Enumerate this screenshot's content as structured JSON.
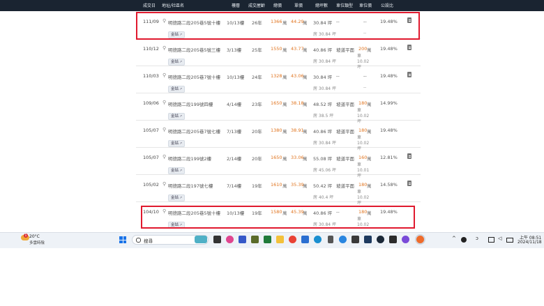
{
  "header": {
    "columns": [
      "成交日",
      "地址/社區名",
      "樓層",
      "成交屋齡",
      "總價",
      "單價",
      "總坪數",
      "車位類型",
      "車位價",
      "公設比"
    ]
  },
  "rows": [
    {
      "date": "111/09",
      "address": "明德路二段205巷5號十樓",
      "floor": "10/13樓",
      "age": "26年",
      "total": "1366",
      "total_unit": "萬",
      "unit_price": "44.29",
      "unit_unit": "萬",
      "area": "30.84 坪",
      "parking_type": "--",
      "parking_price": "",
      "parking_unit": "",
      "parking_dash": "--",
      "ratio": "19.48%",
      "tag": "金姑",
      "sub_area": "房 30.84 坪",
      "sub_parking": "",
      "sub_parking_dash": "--",
      "doc": true
    },
    {
      "date": "110/12",
      "address": "明德路二段205巷5號三樓",
      "floor": "3/13樓",
      "age": "25年",
      "total": "1550",
      "total_unit": "萬",
      "unit_price": "43.77",
      "unit_unit": "萬",
      "area": "40.86 坪",
      "parking_type": "坡道平面",
      "parking_price": "200",
      "parking_unit": "萬",
      "parking_dash": "",
      "ratio": "19.48%",
      "tag": "金姑",
      "sub_area": "房 30.84 坪",
      "sub_parking": "車 10.02 坪",
      "sub_parking_dash": "",
      "doc": true
    },
    {
      "date": "110/03",
      "address": "明德路二段205巷7號十樓",
      "floor": "10/13樓",
      "age": "24年",
      "total": "1328",
      "total_unit": "萬",
      "unit_price": "43.06",
      "unit_unit": "萬",
      "area": "30.84 坪",
      "parking_type": "--",
      "parking_price": "",
      "parking_unit": "",
      "parking_dash": "--",
      "ratio": "19.48%",
      "tag": "金姑",
      "sub_area": "房 30.84 坪",
      "sub_parking": "",
      "sub_parking_dash": "--",
      "doc": true
    },
    {
      "date": "109/06",
      "address": "明德路二段199號四樓",
      "floor": "4/14樓",
      "age": "23年",
      "total": "1650",
      "total_unit": "萬",
      "unit_price": "38.18",
      "unit_unit": "萬",
      "area": "48.52 坪",
      "parking_type": "坡道平面",
      "parking_price": "180",
      "parking_unit": "萬",
      "parking_dash": "",
      "ratio": "14.99%",
      "tag": "金姑",
      "sub_area": "房 38.5 坪",
      "sub_parking": "車 10.02 坪",
      "sub_parking_dash": "",
      "doc": false
    },
    {
      "date": "105/07",
      "address": "明德路二段205巷7號七樓",
      "floor": "7/13樓",
      "age": "20年",
      "total": "1380",
      "total_unit": "萬",
      "unit_price": "38.91",
      "unit_unit": "萬",
      "area": "40.86 坪",
      "parking_type": "坡道平面",
      "parking_price": "180",
      "parking_unit": "萬",
      "parking_dash": "",
      "ratio": "19.48%",
      "tag": "金姑",
      "sub_area": "房 30.84 坪",
      "sub_parking": "車 10.02 坪",
      "sub_parking_dash": "",
      "doc": false
    },
    {
      "date": "105/07",
      "address": "明德路二段199號2樓",
      "floor": "2/14樓",
      "age": "20年",
      "total": "1650",
      "total_unit": "萬",
      "unit_price": "33.06",
      "unit_unit": "萬",
      "area": "55.08 坪",
      "parking_type": "坡道平面",
      "parking_price": "160",
      "parking_unit": "萬",
      "parking_dash": "",
      "ratio": "12.81%",
      "tag": "金姑",
      "sub_area": "房 45.06 坪",
      "sub_parking": "車 10.01 坪",
      "sub_parking_dash": "",
      "doc": true
    },
    {
      "date": "105/02",
      "address": "明德路二段197號七樓",
      "floor": "7/14樓",
      "age": "19年",
      "total": "1610",
      "total_unit": "萬",
      "unit_price": "35.39",
      "unit_unit": "萬",
      "area": "50.42 坪",
      "parking_type": "坡道平面",
      "parking_price": "180",
      "parking_unit": "萬",
      "parking_dash": "",
      "ratio": "14.58%",
      "tag": "金姑",
      "sub_area": "房 40.4 坪",
      "sub_parking": "車 10.02 坪",
      "sub_parking_dash": "",
      "doc": true
    },
    {
      "date": "104/10",
      "address": "明德路二段205巷5號十樓",
      "floor": "10/13樓",
      "age": "19年",
      "total": "1580",
      "total_unit": "萬",
      "unit_price": "45.39",
      "unit_unit": "萬",
      "area": "40.86 坪",
      "parking_type": "--",
      "parking_price": "180",
      "parking_unit": "萬",
      "parking_dash": "",
      "ratio": "19.48%",
      "tag": "金姑",
      "sub_area": "房 30.84 坪",
      "sub_parking": "車 10.02 坪",
      "sub_parking_dash": "",
      "doc": false
    }
  ],
  "taskbar": {
    "weather_temp": "20°C",
    "weather_desc": "多雲時陰",
    "weather_badge": "1",
    "search_text": "搜尋",
    "time": "上午 08:51",
    "date": "2024/11/18"
  },
  "colors": {
    "highlight": "#e0192e",
    "price": "#e0731d",
    "header": "#1a2431"
  }
}
